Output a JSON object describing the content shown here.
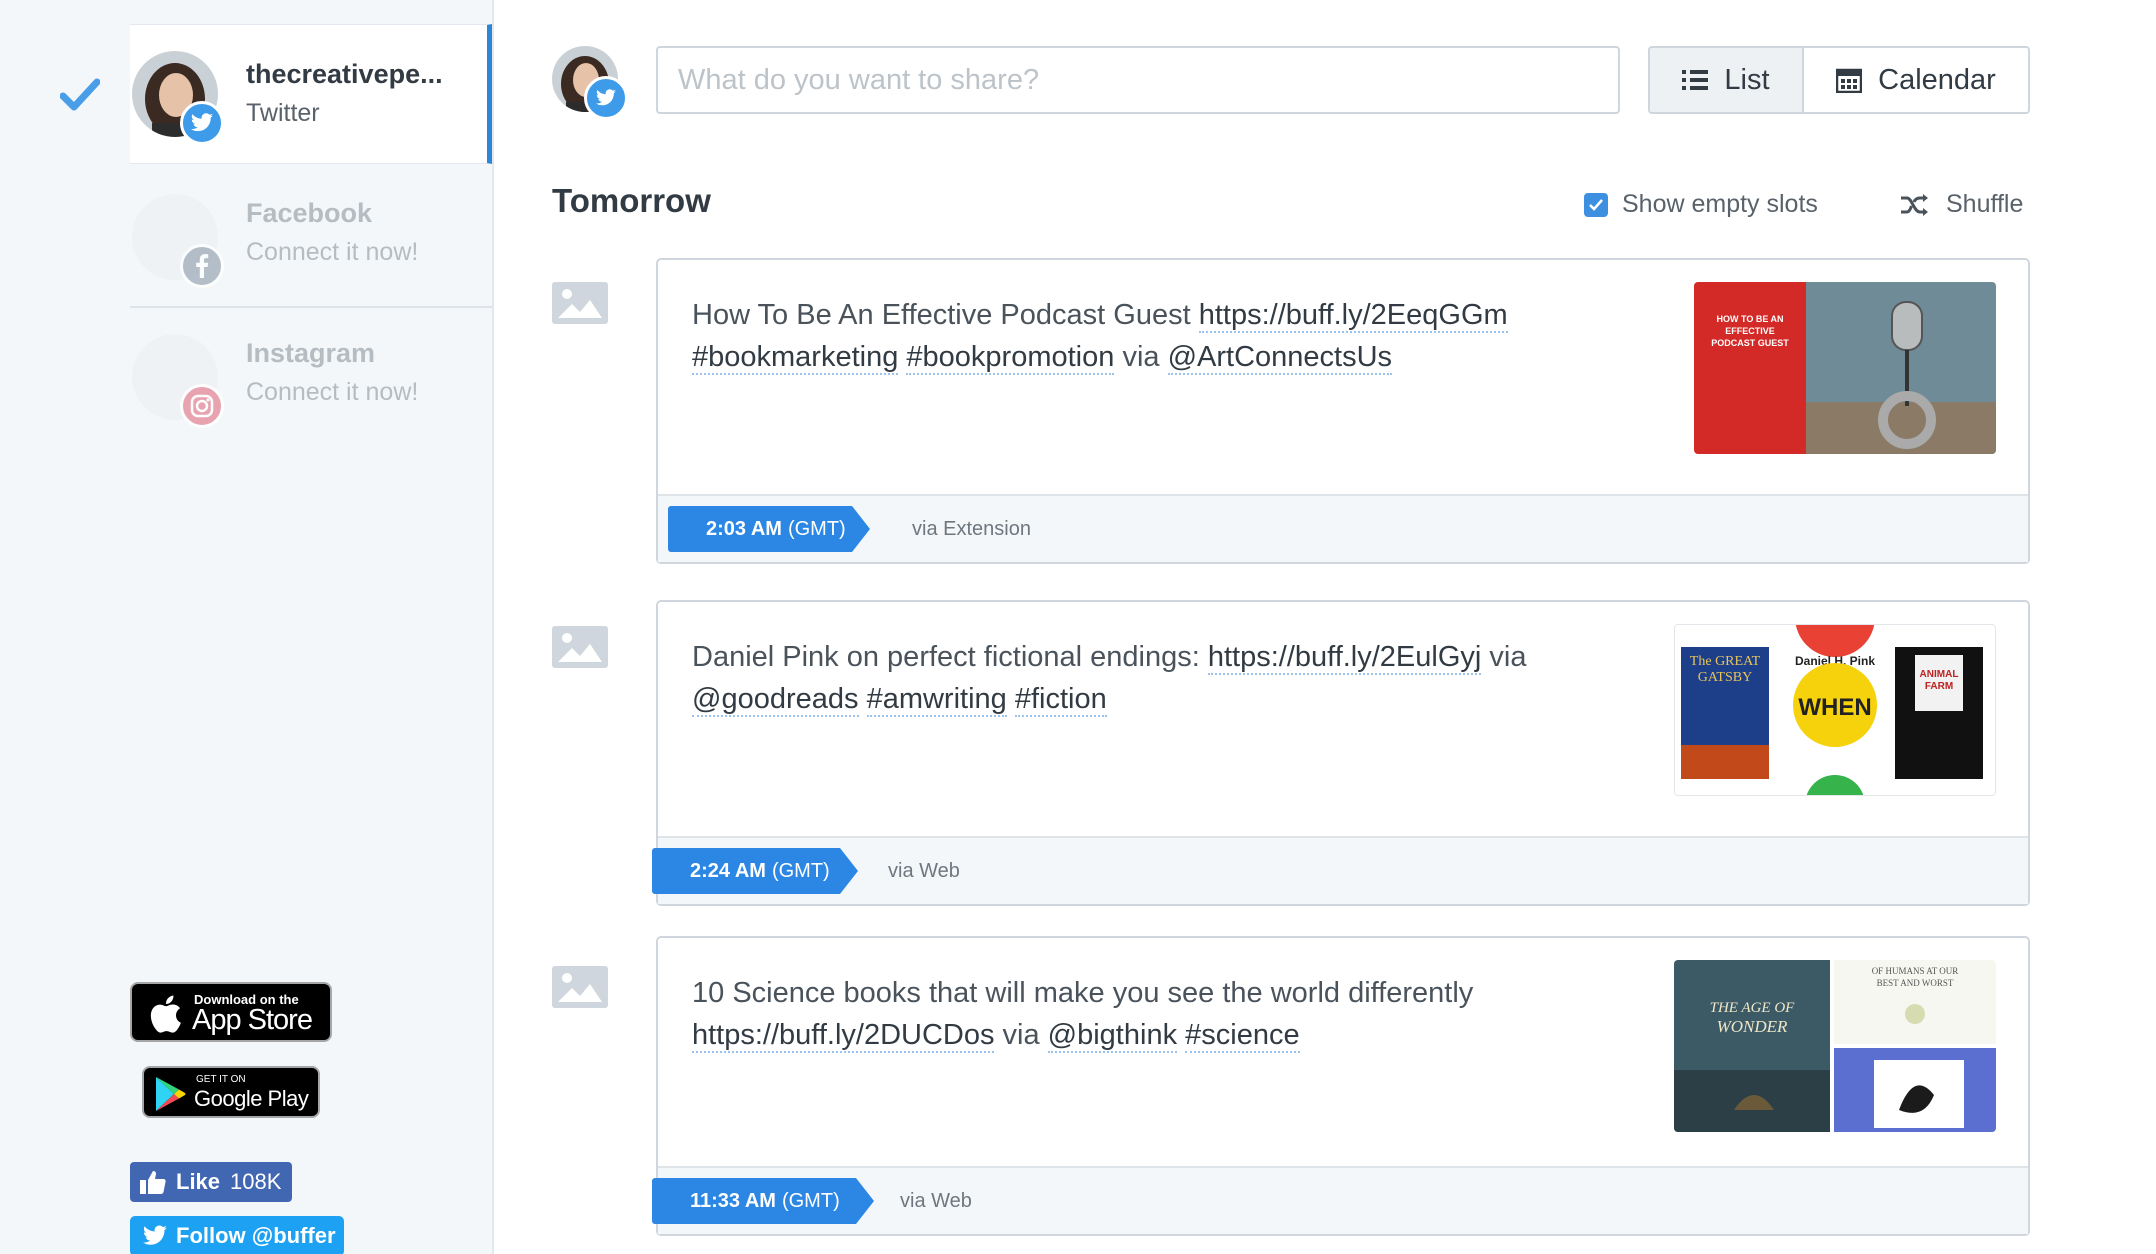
{
  "sidebar": {
    "accounts": [
      {
        "name": "thecreativepe...",
        "network": "Twitter",
        "selected": true
      },
      {
        "name": "Facebook",
        "network": "Connect it now!",
        "selected": false
      },
      {
        "name": "Instagram",
        "network": "Connect it now!",
        "selected": false
      }
    ],
    "app_store": {
      "small": "Download on the",
      "big": "App Store"
    },
    "google_play": {
      "small": "GET IT ON",
      "big": "Google Play"
    },
    "like": {
      "label": "Like",
      "count": "108K"
    },
    "follow": {
      "label": "Follow @buffer"
    }
  },
  "composer": {
    "placeholder": "What do you want to share?"
  },
  "view_toggle": {
    "list_label": "List",
    "calendar_label": "Calendar",
    "active": "List"
  },
  "queue": {
    "day_title": "Tomorrow",
    "show_empty_slots": {
      "label": "Show empty slots",
      "checked": true
    },
    "shuffle_label": "Shuffle",
    "posts": [
      {
        "text_before": "How To Be An Effective Podcast Guest ",
        "link1": "https://buff.ly/2EeqGGm",
        "link2": "#bookmarketing",
        "link3": "#bookpromotion",
        "via_text": " via ",
        "link4": "@ArtConnectsUs",
        "time": "2:03 AM",
        "tz": "(GMT)",
        "source": "via Extension",
        "thumb_text": "HOW TO BE AN EFFECTIVE PODCAST GUEST"
      },
      {
        "text_before": "Daniel Pink on perfect fictional endings: ",
        "link1": "https://buff.ly/2EulGyj",
        "via_text": " via ",
        "link2": "@goodreads",
        "link3": "#amwriting",
        "link4": "#fiction",
        "time": "2:24 AM",
        "tz": "(GMT)",
        "source": "via Web",
        "thumb_text": {
          "book1": "The GREAT GATSBY",
          "author2": "Daniel H. Pink",
          "book2": "WHEN",
          "book3": "ANIMAL FARM"
        }
      },
      {
        "text_before": "10 Science books that will make you see the world differently ",
        "link1": "https://buff.ly/2DUCDos",
        "via_text": " via ",
        "link2": "@bigthink",
        "link3": "#science",
        "time": "11:33 AM",
        "tz": "(GMT)",
        "source": "via Web",
        "thumb_text": {
          "book1": "THE AGE OF WONDER",
          "book2": "OF HUMANS AT OUR BEST AND WORST"
        }
      }
    ]
  },
  "colors": {
    "accent": "#2b87e3",
    "twitter": "#3d9be9",
    "sidebar_bg": "#f4f7f9",
    "border": "#cfd6dd"
  },
  "icons": [
    "check-icon",
    "twitter-icon",
    "facebook-icon",
    "instagram-icon",
    "list-icon",
    "calendar-icon",
    "shuffle-icon",
    "image-placeholder-icon",
    "apple-icon",
    "google-play-icon",
    "thumbs-up-icon"
  ]
}
